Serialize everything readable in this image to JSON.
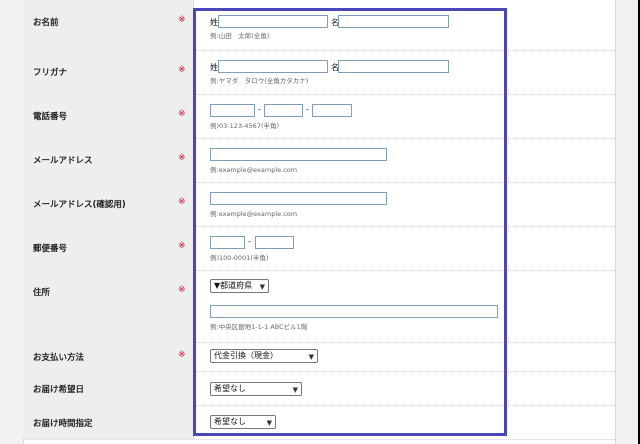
{
  "req_mark": "※",
  "fields": {
    "name": {
      "label": "お名前",
      "sei": "姓",
      "mei": "名",
      "hint": "例:山田　太郎(全角)"
    },
    "kana": {
      "label": "フリガナ",
      "sei": "姓",
      "mei": "名",
      "hint": "例:ヤマダ　タロウ(全角カタカナ)"
    },
    "tel": {
      "label": "電話番号",
      "sep": "-",
      "hint": "例)03-123-4567(半角)"
    },
    "email": {
      "label": "メールアドレス",
      "hint": "例:example@example.com"
    },
    "email_confirm": {
      "label": "メールアドレス(確認用)",
      "hint": "例:example@example.com"
    },
    "zip": {
      "label": "郵便番号",
      "sep": "-",
      "hint": "例)100-0001(半角)"
    },
    "address": {
      "label": "住所",
      "pref_select": "▼都道府県",
      "hint": "例:中央区銀地1-1-1 ABCビル1階"
    },
    "payment": {
      "label": "お支払い方法",
      "value": "代金引換（現金）"
    },
    "delivery_date": {
      "label": "お届け希望日",
      "value": "希望なし"
    },
    "delivery_time": {
      "label": "お届け時間指定",
      "value": "希望なし"
    }
  },
  "colors": {
    "required": "#d0102b",
    "frame": "#4a48b8",
    "input_border": "#7f9db9",
    "label_bg": "#eeeeee"
  },
  "icons": {
    "select_arrow": "chevron-down-icon"
  }
}
